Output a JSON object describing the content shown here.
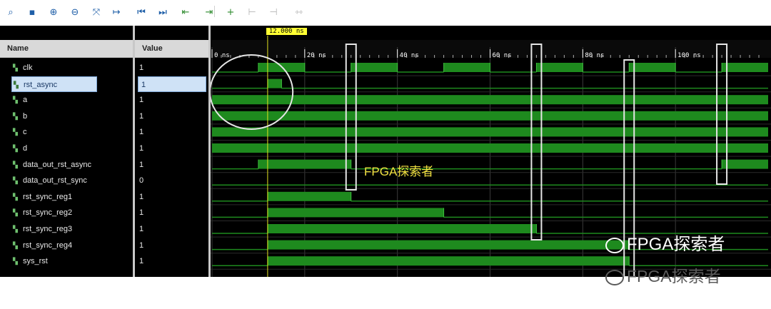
{
  "toolbar": {
    "icons": [
      "search-icon",
      "save-icon",
      "zoom-in-icon",
      "zoom-out-icon",
      "zoom-fit-icon",
      "go-to-cursor-icon",
      "go-to-start-icon",
      "go-to-end-icon",
      "previous-transition-icon",
      "next-transition-icon",
      "add-marker-icon",
      "previous-marker-icon",
      "next-marker-icon",
      "swap-cursors-icon"
    ]
  },
  "headers": {
    "name": "Name",
    "value": "Value"
  },
  "signals": [
    {
      "name": "clk",
      "value": "1",
      "selected": false
    },
    {
      "name": "rst_async",
      "value": "1",
      "selected": true
    },
    {
      "name": "a",
      "value": "1",
      "selected": false
    },
    {
      "name": "b",
      "value": "1",
      "selected": false
    },
    {
      "name": "c",
      "value": "1",
      "selected": false
    },
    {
      "name": "d",
      "value": "1",
      "selected": false
    },
    {
      "name": "data_out_rst_async",
      "value": "1",
      "selected": false
    },
    {
      "name": "data_out_rst_sync",
      "value": "0",
      "selected": false
    },
    {
      "name": "rst_sync_reg1",
      "value": "1",
      "selected": false
    },
    {
      "name": "rst_sync_reg2",
      "value": "1",
      "selected": false
    },
    {
      "name": "rst_sync_reg3",
      "value": "1",
      "selected": false
    },
    {
      "name": "rst_sync_reg4",
      "value": "1",
      "selected": false
    },
    {
      "name": "sys_rst",
      "value": "1",
      "selected": false
    }
  ],
  "timeline": {
    "cursor_label": "12.000 ns",
    "cursor_time": 12,
    "ticks": [
      "0 ns",
      "20 ns",
      "40 ns",
      "60 ns",
      "80 ns",
      "100 ns"
    ],
    "tick_values": [
      0,
      20,
      40,
      60,
      80,
      100
    ],
    "time_max": 120
  },
  "waveforms": [
    {
      "name": "clk",
      "levels": [
        [
          0,
          0
        ],
        [
          10,
          1
        ],
        [
          20,
          0
        ],
        [
          30,
          1
        ],
        [
          40,
          0
        ],
        [
          50,
          1
        ],
        [
          60,
          0
        ],
        [
          70,
          1
        ],
        [
          80,
          0
        ],
        [
          90,
          1
        ],
        [
          100,
          0
        ],
        [
          110,
          1
        ],
        [
          120,
          1
        ]
      ]
    },
    {
      "name": "rst_async",
      "levels": [
        [
          0,
          0
        ],
        [
          12,
          1
        ],
        [
          15,
          0
        ],
        [
          120,
          0
        ]
      ]
    },
    {
      "name": "a",
      "levels": [
        [
          0,
          1
        ],
        [
          120,
          1
        ]
      ]
    },
    {
      "name": "b",
      "levels": [
        [
          0,
          1
        ],
        [
          120,
          1
        ]
      ]
    },
    {
      "name": "c",
      "levels": [
        [
          0,
          1
        ],
        [
          120,
          1
        ]
      ]
    },
    {
      "name": "d",
      "levels": [
        [
          0,
          1
        ],
        [
          120,
          1
        ]
      ]
    },
    {
      "name": "data_out_rst_async",
      "levels": [
        [
          0,
          0
        ],
        [
          10,
          1
        ],
        [
          30,
          0
        ],
        [
          110,
          1
        ],
        [
          120,
          1
        ]
      ]
    },
    {
      "name": "data_out_rst_sync",
      "levels": [
        [
          0,
          0
        ],
        [
          120,
          0
        ]
      ]
    },
    {
      "name": "rst_sync_reg1",
      "levels": [
        [
          0,
          0
        ],
        [
          12,
          1
        ],
        [
          30,
          0
        ],
        [
          120,
          0
        ]
      ]
    },
    {
      "name": "rst_sync_reg2",
      "levels": [
        [
          0,
          0
        ],
        [
          12,
          1
        ],
        [
          50,
          0
        ],
        [
          120,
          0
        ]
      ]
    },
    {
      "name": "rst_sync_reg3",
      "levels": [
        [
          0,
          0
        ],
        [
          12,
          1
        ],
        [
          70,
          0
        ],
        [
          120,
          0
        ]
      ]
    },
    {
      "name": "rst_sync_reg4",
      "levels": [
        [
          0,
          0
        ],
        [
          12,
          1
        ],
        [
          90,
          0
        ],
        [
          120,
          0
        ]
      ]
    },
    {
      "name": "sys_rst",
      "levels": [
        [
          0,
          0
        ],
        [
          12,
          1
        ],
        [
          90,
          0
        ],
        [
          120,
          0
        ]
      ]
    }
  ],
  "overlay_text": "FPGA探索者",
  "watermarks": [
    "FPGA探索者",
    "FPGA探索者"
  ],
  "colors": {
    "wave": "#1e8a1e",
    "cursor": "#e0e020",
    "annotation": "#ffffff",
    "overlay": "#f0e040"
  }
}
